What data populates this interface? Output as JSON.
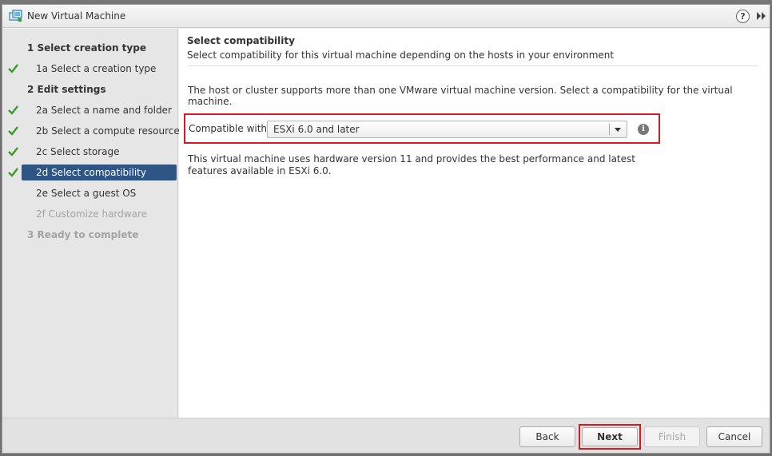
{
  "window": {
    "title": "New Virtual Machine",
    "help_symbol": "?"
  },
  "sidebar": {
    "steps": [
      {
        "label": "1  Select creation type",
        "kind": "group",
        "checked": false,
        "state": "normal"
      },
      {
        "label": "1a  Select a creation type",
        "kind": "sub",
        "checked": true,
        "state": "normal"
      },
      {
        "label": "2  Edit settings",
        "kind": "group",
        "checked": false,
        "state": "normal"
      },
      {
        "label": "2a  Select a name and folder",
        "kind": "sub",
        "checked": true,
        "state": "normal"
      },
      {
        "label": "2b  Select a compute resource",
        "kind": "sub",
        "checked": true,
        "state": "normal"
      },
      {
        "label": "2c  Select storage",
        "kind": "sub",
        "checked": true,
        "state": "normal"
      },
      {
        "label": "2d  Select compatibility",
        "kind": "sub",
        "checked": true,
        "state": "active"
      },
      {
        "label": "2e  Select a guest OS",
        "kind": "sub",
        "checked": false,
        "state": "normal"
      },
      {
        "label": "2f  Customize hardware",
        "kind": "sub",
        "checked": false,
        "state": "disabled"
      },
      {
        "label": "3  Ready to complete",
        "kind": "group",
        "checked": false,
        "state": "disabled"
      }
    ]
  },
  "content": {
    "title": "Select compatibility",
    "subtitle": "Select compatibility for this virtual machine depending on the hosts in your environment",
    "intro": "The host or cluster supports more than one VMware virtual machine version. Select a compatibility for the virtual machine.",
    "compat_label": "Compatible with:",
    "compat_value": "ESXi 6.0 and later",
    "info_symbol": "i",
    "description": "This virtual machine uses hardware version 11 and provides the best performance and latest features available in ESXi 6.0."
  },
  "footer": {
    "back_label": "Back",
    "next_label": "Next",
    "finish_label": "Finish",
    "cancel_label": "Cancel"
  },
  "colors": {
    "active_step": "#2d5586",
    "check": "#3a9a2a",
    "highlight_box": "#d71920"
  }
}
